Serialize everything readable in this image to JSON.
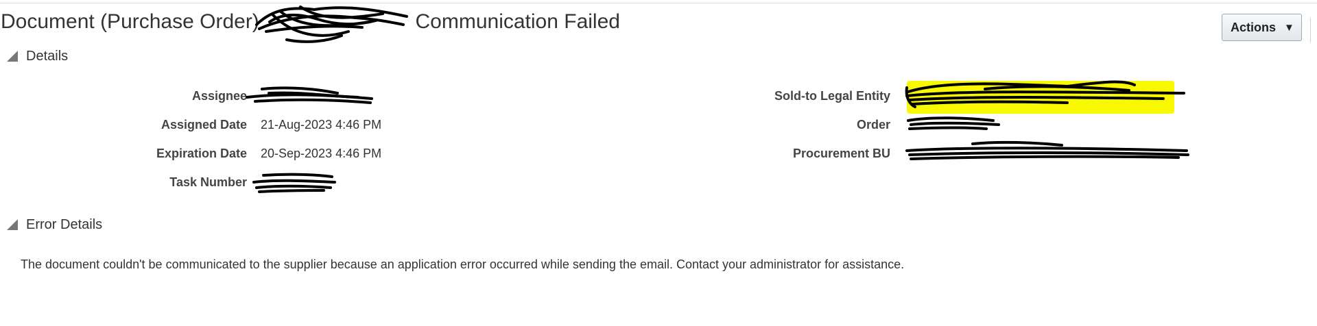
{
  "header": {
    "title_prefix": "Document (Purchase Order)",
    "title_suffix": "Communication Failed",
    "actions_label": "Actions",
    "actions_caret": "▼"
  },
  "details_section": {
    "title": "Details",
    "left_fields": [
      {
        "label": "Assignee",
        "value": ""
      },
      {
        "label": "Assigned Date",
        "value": "21-Aug-2023 4:46 PM"
      },
      {
        "label": "Expiration Date",
        "value": "20-Sep-2023 4:46 PM"
      },
      {
        "label": "Task Number",
        "value": ""
      }
    ],
    "right_fields": [
      {
        "label": "Sold-to Legal Entity",
        "value": ""
      },
      {
        "label": "Order",
        "value": ""
      },
      {
        "label": "Procurement BU",
        "value": ""
      }
    ]
  },
  "error_section": {
    "title": "Error Details",
    "message": "The document couldn't be communicated to the supplier because an application error occurred while sending the email. Contact your administrator for assistance."
  },
  "colors": {
    "redaction_ink": "#000000",
    "highlight": "#f8f800",
    "button_border": "#9aa7b4"
  },
  "icons": {
    "disclosure": "triangle-down-right-icon",
    "dropdown": "caret-down-icon"
  }
}
